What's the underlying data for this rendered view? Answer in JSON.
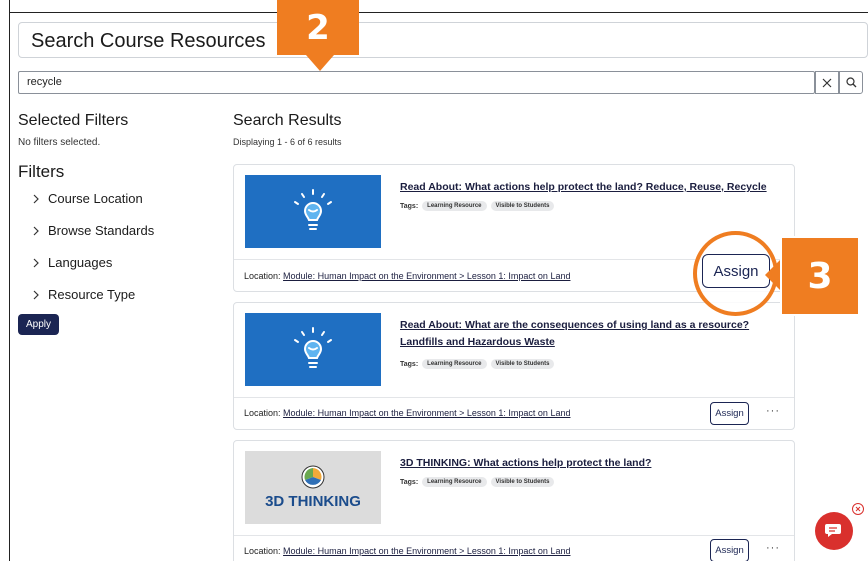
{
  "header": {
    "title": "Search Course Resources"
  },
  "search": {
    "value": "recycle",
    "clear_icon": "close-icon",
    "search_icon": "search-icon"
  },
  "sidebar": {
    "selected_filters_heading": "Selected Filters",
    "no_filters_text": "No filters selected.",
    "filters_heading": "Filters",
    "filters": [
      {
        "label": "Course Location"
      },
      {
        "label": "Browse Standards"
      },
      {
        "label": "Languages"
      },
      {
        "label": "Resource Type"
      }
    ],
    "apply_label": "Apply"
  },
  "results": {
    "heading": "Search Results",
    "count_text": "Displaying 1 - 6 of 6 results",
    "location_prefix": "Location:",
    "tags_label": "Tags:",
    "assign_label": "Assign",
    "more_label": "···",
    "items": [
      {
        "title": "Read About: What actions help protect the land? Reduce, Reuse, Recycle",
        "tags": [
          "Learning Resource",
          "Visible to Students"
        ],
        "location": "Module: Human Impact on the Environment > Lesson 1: Impact on Land",
        "thumb_icon": "lightbulb-icon"
      },
      {
        "title": "Read About: What are the consequences of using land as a resource? Landfills and Hazardous Waste",
        "tags": [
          "Learning Resource",
          "Visible to Students"
        ],
        "location": "Module: Human Impact on the Environment > Lesson 1: Impact on Land",
        "thumb_icon": "lightbulb-icon"
      },
      {
        "title": "3D THINKING: What actions help protect the land?",
        "tags": [
          "Learning Resource",
          "Visible to Students"
        ],
        "location": "Module: Human Impact on the Environment > Lesson 1: Impact on Land",
        "thumb_text": "3D THINKING"
      }
    ]
  },
  "callouts": {
    "step2": "2",
    "step3": "3",
    "highlight_label": "Assign"
  },
  "colors": {
    "accent": "#ef7d21",
    "navy": "#1b2553",
    "thumb_blue": "#1f6fc2",
    "chat_red": "#d9302d"
  }
}
